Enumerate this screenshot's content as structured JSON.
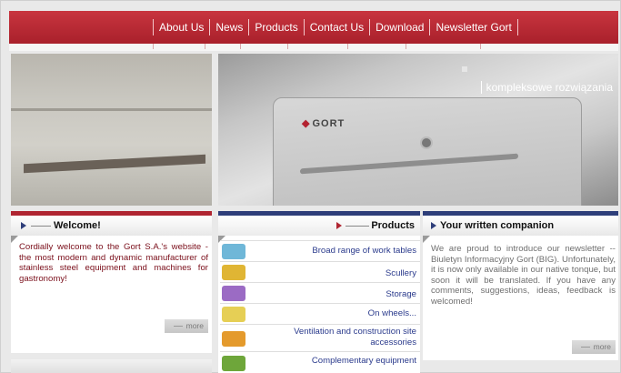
{
  "nav": {
    "items": [
      "About Us",
      "News",
      "Products",
      "Contact Us",
      "Download",
      "Newsletter Gort"
    ]
  },
  "hero": {
    "logo_text": "GORT",
    "tagline": "kompleksowe rozwiązania"
  },
  "welcome": {
    "title": "Welcome!",
    "text": "Cordially welcome to the Gort S.A.'s website - the most modern and dynamic manufacturer of stainless steel equipment and machines for gastronomy!",
    "more_label": "more"
  },
  "products": {
    "title": "Products",
    "items": [
      {
        "label": "Broad range of work tables",
        "icon": "work-table-icon",
        "color": "#6fb7d8"
      },
      {
        "label": "Scullery",
        "icon": "scullery-icon",
        "color": "#e0b534"
      },
      {
        "label": "Storage",
        "icon": "storage-icon",
        "color": "#9b6bc4"
      },
      {
        "label": "On wheels...",
        "icon": "wheels-icon",
        "color": "#e6cf55"
      },
      {
        "label": "Ventilation and construction site accessories",
        "icon": "ventilation-icon",
        "color": "#e49a2c"
      },
      {
        "label": "Complementary equipment",
        "icon": "equipment-icon",
        "color": "#6ea63a"
      }
    ]
  },
  "companion": {
    "title": "Your written companion",
    "text": "We are proud to introduce our newsletter -- Biuletyn Informacyjny Gort (BIG). Unfortunately, it is now only available in our native tonque, but soon it will be translated. If you have any comments, suggestions, ideas, feedback is welcomed!",
    "more_label": "more"
  },
  "colors": {
    "brand_red": "#b02531",
    "brand_blue": "#2e3e7a"
  }
}
